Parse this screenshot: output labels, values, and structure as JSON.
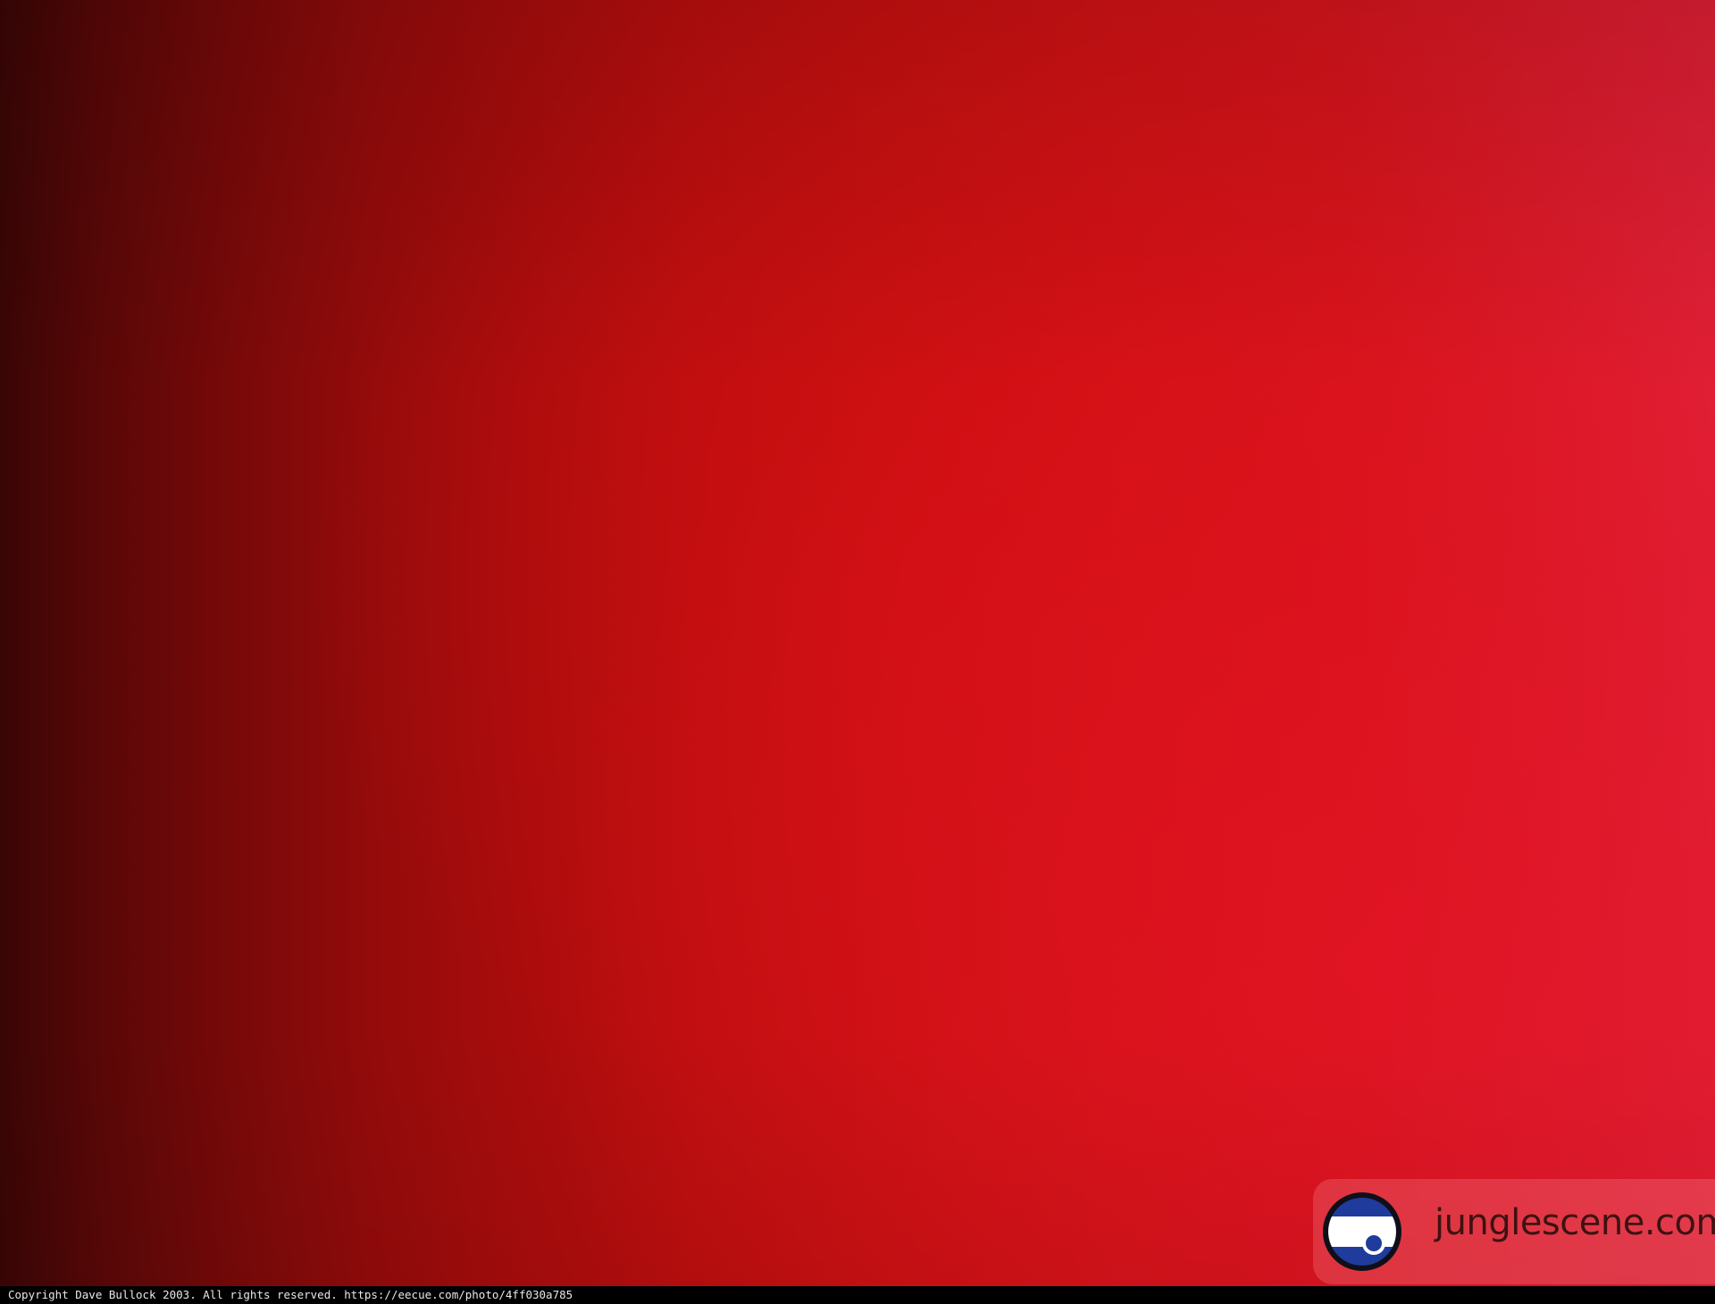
{
  "watermark": {
    "text": "junglescene.com",
    "icon": "eye-logo-icon",
    "colors": {
      "ring": "#0f0f1a",
      "blue": "#1f3c9c",
      "white": "#ffffff"
    }
  },
  "copyright": {
    "text": "Copyright Dave Bullock 2003. All rights reserved. https://eecue.com/photo/4ff030a785"
  },
  "colors": {
    "left": "#3a0505",
    "center": "#c81010",
    "right": "#e01f35"
  }
}
